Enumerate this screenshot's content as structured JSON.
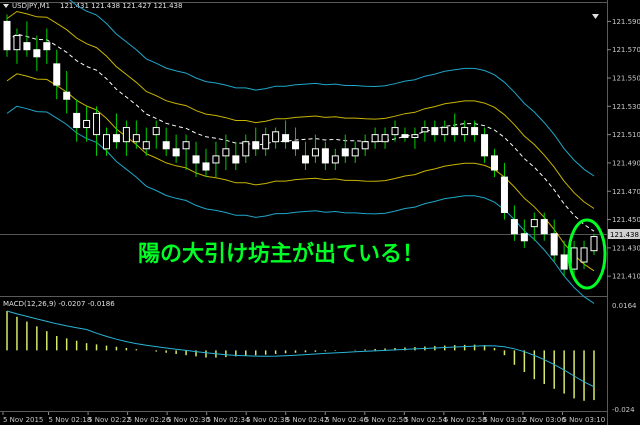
{
  "header": {
    "symbol": "USDJPY,M1",
    "ohlc": "121.431 121.438 121.427 121.438",
    "macd_label": "MACD(12,26,9) -0.0207 -0.0186"
  },
  "annotation": "陽の大引け坊主が出ている！",
  "price_axis": [
    "121.590",
    "121.570",
    "121.550",
    "121.530",
    "121.510",
    "121.490",
    "121.470",
    "121.450",
    "121.430",
    "121.410"
  ],
  "current_price": "121.438",
  "macd_axis": {
    "top": "0.0164",
    "bottom": "-0.024"
  },
  "time_axis": [
    "5 Nov 2015",
    "5 Nov 02:18",
    "5 Nov 02:22",
    "5 Nov 02:26",
    "5 Nov 02:30",
    "5 Nov 02:34",
    "5 Nov 02:38",
    "5 Nov 02:42",
    "5 Nov 02:46",
    "5 Nov 02:50",
    "5 Nov 02:54",
    "5 Nov 02:58",
    "5 Nov 03:02",
    "5 Nov 03:06",
    "5 Nov 03:10"
  ],
  "colors": {
    "bull": "#ffffff",
    "bear": "#ffffff",
    "wick": "#00d000",
    "band_outer": "#1fa6c9",
    "band_inner": "#c8b400",
    "ma": "#ffffff",
    "macd_hist": "#d8e86a",
    "signal": "#2ab5d6",
    "highlight": "#00ff24"
  },
  "chart_data": {
    "type": "candlestick",
    "ylim": [
      121.396,
      121.603
    ],
    "candles": [
      [
        121.59,
        121.595,
        121.565,
        121.57
      ],
      [
        121.57,
        121.585,
        121.56,
        121.58
      ],
      [
        121.575,
        121.59,
        121.565,
        121.57
      ],
      [
        121.57,
        121.58,
        121.555,
        121.565
      ],
      [
        121.575,
        121.585,
        121.56,
        121.57
      ],
      [
        121.56,
        121.57,
        121.535,
        121.545
      ],
      [
        121.54,
        121.555,
        121.525,
        121.535
      ],
      [
        121.525,
        121.535,
        121.505,
        121.515
      ],
      [
        121.515,
        121.53,
        121.505,
        121.52
      ],
      [
        121.51,
        121.53,
        121.495,
        121.525
      ],
      [
        121.5,
        121.515,
        121.495,
        121.51
      ],
      [
        121.51,
        121.525,
        121.5,
        121.505
      ],
      [
        121.505,
        121.52,
        121.495,
        121.515
      ],
      [
        121.505,
        121.52,
        121.5,
        121.51
      ],
      [
        121.5,
        121.515,
        121.495,
        121.505
      ],
      [
        121.51,
        121.52,
        121.5,
        121.515
      ],
      [
        121.505,
        121.515,
        121.495,
        121.5
      ],
      [
        121.5,
        121.51,
        121.49,
        121.495
      ],
      [
        121.5,
        121.51,
        121.485,
        121.505
      ],
      [
        121.495,
        121.505,
        121.48,
        121.49
      ],
      [
        121.49,
        121.5,
        121.48,
        121.485
      ],
      [
        121.49,
        121.505,
        121.48,
        121.495
      ],
      [
        121.495,
        121.51,
        121.485,
        121.5
      ],
      [
        121.495,
        121.505,
        121.485,
        121.49
      ],
      [
        121.495,
        121.51,
        121.49,
        121.505
      ],
      [
        121.505,
        121.515,
        121.495,
        121.5
      ],
      [
        121.5,
        121.515,
        121.495,
        121.51
      ],
      [
        121.505,
        121.515,
        121.5,
        121.512
      ],
      [
        121.51,
        121.52,
        121.5,
        121.505
      ],
      [
        121.505,
        121.515,
        121.495,
        121.5
      ],
      [
        121.495,
        121.505,
        121.485,
        121.49
      ],
      [
        121.495,
        121.51,
        121.49,
        121.5
      ],
      [
        121.5,
        121.505,
        121.485,
        121.49
      ],
      [
        121.49,
        121.5,
        121.485,
        121.495
      ],
      [
        121.5,
        121.51,
        121.49,
        121.495
      ],
      [
        121.495,
        121.505,
        121.49,
        121.5
      ],
      [
        121.5,
        121.51,
        121.495,
        121.505
      ],
      [
        121.505,
        121.515,
        121.5,
        121.51
      ],
      [
        121.505,
        121.515,
        121.5,
        121.51
      ],
      [
        121.51,
        121.52,
        121.505,
        121.515
      ],
      [
        121.51,
        121.515,
        121.505,
        121.508
      ],
      [
        121.508,
        121.515,
        121.5,
        121.51
      ],
      [
        121.512,
        121.52,
        121.505,
        121.515
      ],
      [
        121.515,
        121.52,
        121.505,
        121.51
      ],
      [
        121.51,
        121.52,
        121.505,
        121.515
      ],
      [
        121.515,
        121.525,
        121.505,
        121.51
      ],
      [
        121.51,
        121.52,
        121.505,
        121.515
      ],
      [
        121.515,
        121.52,
        121.505,
        121.51
      ],
      [
        121.51,
        121.515,
        121.49,
        121.495
      ],
      [
        121.495,
        121.5,
        121.48,
        121.485
      ],
      [
        121.48,
        121.49,
        121.45,
        121.455
      ],
      [
        121.45,
        121.46,
        121.435,
        121.44
      ],
      [
        121.44,
        121.45,
        121.43,
        121.435
      ],
      [
        121.445,
        121.455,
        121.435,
        121.45
      ],
      [
        121.45,
        121.455,
        121.435,
        121.44
      ],
      [
        121.44,
        121.45,
        121.42,
        121.425
      ],
      [
        121.425,
        121.435,
        121.41,
        121.415
      ],
      [
        121.415,
        121.435,
        121.41,
        121.43
      ],
      [
        121.42,
        121.435,
        121.415,
        121.43
      ],
      [
        121.428,
        121.44,
        121.425,
        121.438
      ]
    ],
    "macd": [
      0.0164,
      0.014,
      0.012,
      0.01,
      0.008,
      0.006,
      0.005,
      0.004,
      0.003,
      0.0025,
      0.002,
      0.0015,
      0.001,
      0.0005,
      0.0,
      -0.0005,
      -0.001,
      -0.0015,
      -0.002,
      -0.0025,
      -0.003,
      -0.003,
      -0.0028,
      -0.0025,
      -0.0022,
      -0.002,
      -0.0018,
      -0.0015,
      -0.0012,
      -0.001,
      -0.0008,
      -0.0006,
      -0.0004,
      -0.0002,
      0.0,
      0.0002,
      0.0004,
      0.0006,
      0.0008,
      0.001,
      0.0012,
      0.0014,
      0.0016,
      0.0018,
      0.002,
      0.0022,
      0.0023,
      0.0024,
      0.0022,
      0.001,
      -0.002,
      -0.006,
      -0.009,
      -0.012,
      -0.014,
      -0.016,
      -0.018,
      -0.02,
      -0.021,
      -0.0207
    ],
    "macd_ylim": [
      -0.024,
      0.0164
    ]
  }
}
